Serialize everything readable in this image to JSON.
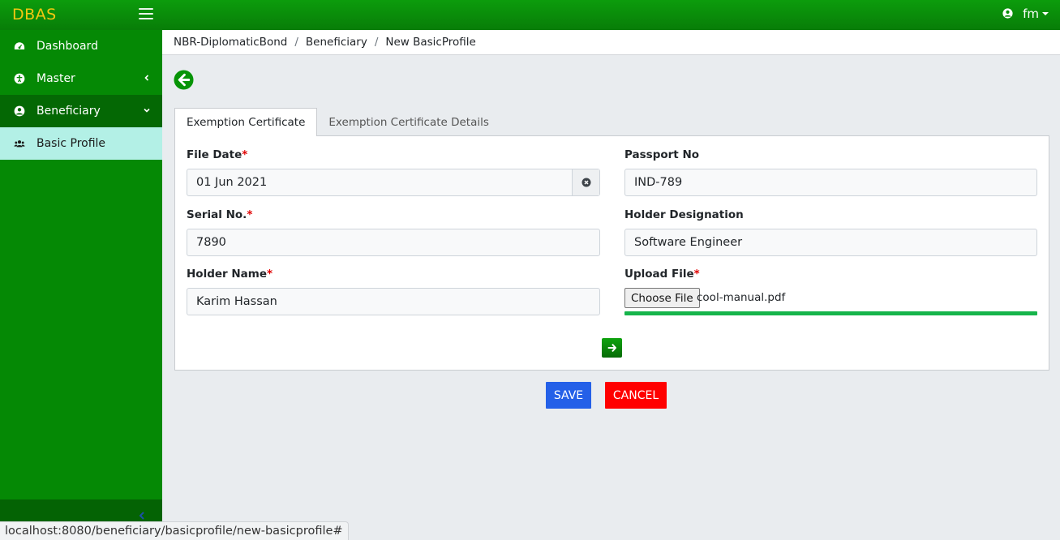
{
  "app": {
    "brand": "DBAS",
    "user": "fm"
  },
  "sidebar": {
    "items": [
      {
        "label": "Dashboard",
        "icon": "dashboard-icon"
      },
      {
        "label": "Master",
        "icon": "universal-access-icon"
      },
      {
        "label": "Beneficiary",
        "icon": "user-circle-icon"
      },
      {
        "label": "Basic Profile",
        "icon": "users-icon"
      }
    ]
  },
  "breadcrumb": {
    "items": [
      "NBR-DiplomaticBond",
      "Beneficiary",
      "New BasicProfile"
    ],
    "separator": "/"
  },
  "tabs": [
    {
      "label": "Exemption Certificate",
      "active": true
    },
    {
      "label": "Exemption Certificate Details",
      "active": false
    }
  ],
  "form": {
    "file_date": {
      "label": "File Date",
      "required": "*",
      "value": "01 Jun 2021"
    },
    "serial_no": {
      "label": "Serial No.",
      "required": "*",
      "value": "7890"
    },
    "holder_name": {
      "label": "Holder Name",
      "required": "*",
      "value": "Karim Hassan"
    },
    "passport_no": {
      "label": "Passport No",
      "value": "IND-789"
    },
    "holder_designation": {
      "label": "Holder Designation",
      "value": "Software Engineer"
    },
    "upload_file": {
      "label": "Upload File",
      "required": "*",
      "button": "Choose File",
      "file_name": "cool-manual.pdf",
      "progress": 1.0
    }
  },
  "actions": {
    "save": "SAVE",
    "cancel": "CANCEL"
  },
  "status_url": "localhost:8080/beneficiary/basicprofile/new-basicprofile#",
  "colors": {
    "topbar": "#0a8f0a",
    "sidebar": "#058905",
    "brand": "#f2c811",
    "active_item": "#b3f0e6",
    "save": "#2460e8",
    "cancel": "#ff0000",
    "progress": "#16b44b"
  }
}
